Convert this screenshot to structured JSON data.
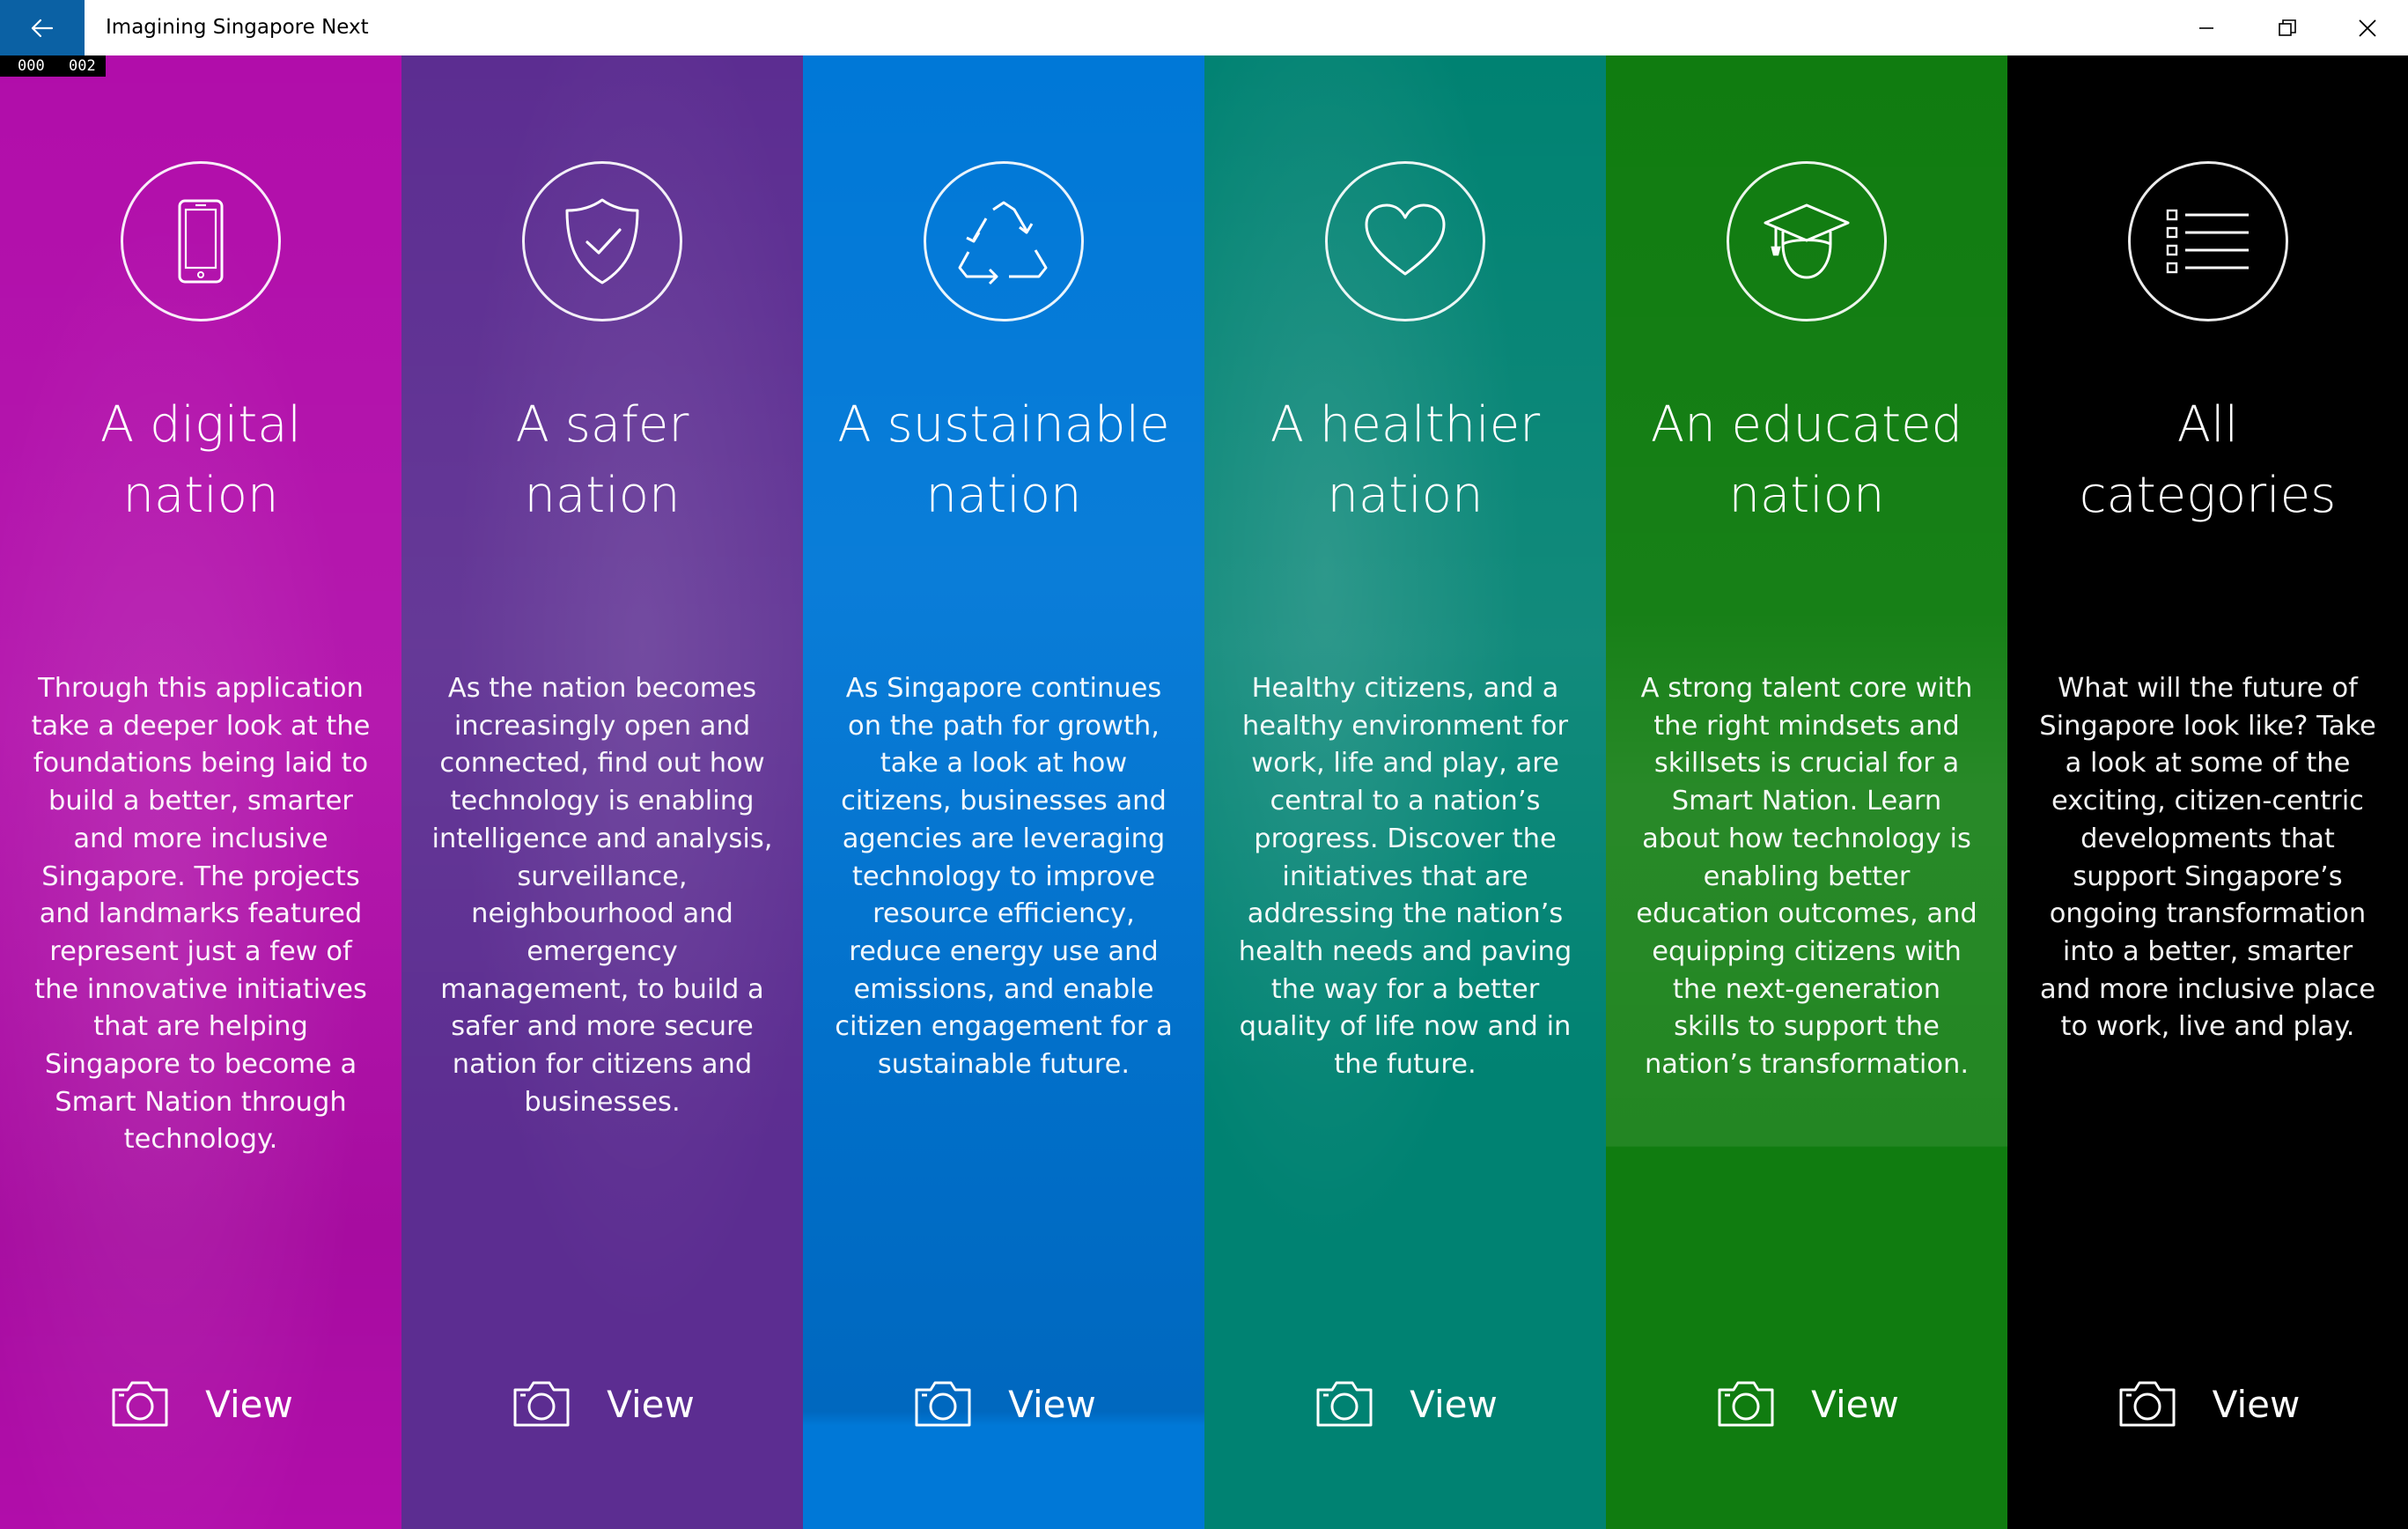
{
  "window": {
    "title": "Imagining Singapore Next",
    "back_icon": "back-arrow-icon",
    "controls": [
      "minimize-icon",
      "restore-icon",
      "close-icon"
    ],
    "frame_counter": [
      "000",
      "002"
    ]
  },
  "panels": [
    {
      "id": "digital",
      "icon": "phone-icon",
      "color": "#b10daa",
      "title_line1": "A digital",
      "title_line2": "nation",
      "description": "Through this application take a deeper look at the foundations being laid to build a better, smarter and more inclusive Singapore. The projects and landmarks featured represent just a few of the innovative initiatives that are helping Singapore to become a Smart Nation through technology.",
      "view_label": "View",
      "view_icon": "camera-icon"
    },
    {
      "id": "safer",
      "icon": "shield-check-icon",
      "color": "#5c2d91",
      "title_line1": "A safer",
      "title_line2": "nation",
      "description": "As the nation becomes increasingly open and connected, find out how technology is enabling intelligence and analysis, surveillance, neighbourhood and emergency management, to build a safer and more secure nation for citizens and businesses.",
      "view_label": "View",
      "view_icon": "camera-icon"
    },
    {
      "id": "sustainable",
      "icon": "recycle-icon",
      "color": "#0078d7",
      "title_line1": "A sustainable",
      "title_line2": "nation",
      "description": "As Singapore continues on the path for growth, take a look at how citizens, businesses and agencies are leveraging technology to improve resource efficiency, reduce energy use and emissions, and enable citizen engagement for a sustainable future.",
      "view_label": "View",
      "view_icon": "camera-icon"
    },
    {
      "id": "healthier",
      "icon": "heart-icon",
      "color": "#008272",
      "title_line1": "A healthier",
      "title_line2": "nation",
      "description": "Healthy citizens, and a healthy environment for work, life and play, are central to a nation’s progress. Discover the initiatives that are addressing the nation’s health needs and paving the way for a better quality of life now and in the future.",
      "view_label": "View",
      "view_icon": "camera-icon"
    },
    {
      "id": "educated",
      "icon": "graduate-icon",
      "color": "#107c10",
      "title_line1": "An educated",
      "title_line2": "nation",
      "description": "A strong talent core with the right mindsets and skillsets is crucial for a Smart Nation. Learn about how technology is enabling better education outcomes, and equipping citizens with the next-generation skills to support the nation’s transformation.",
      "view_label": "View",
      "view_icon": "camera-icon"
    },
    {
      "id": "all",
      "icon": "list-icon",
      "color": "#000000",
      "title_line1": "All",
      "title_line2": "categories",
      "description": "What will the future of Singapore look like? Take a look at some of the exciting, citizen-centric developments that support Singapore’s ongoing transformation into a better, smarter and more inclusive place to work, live and play.",
      "view_label": "View",
      "view_icon": "camera-icon"
    }
  ]
}
